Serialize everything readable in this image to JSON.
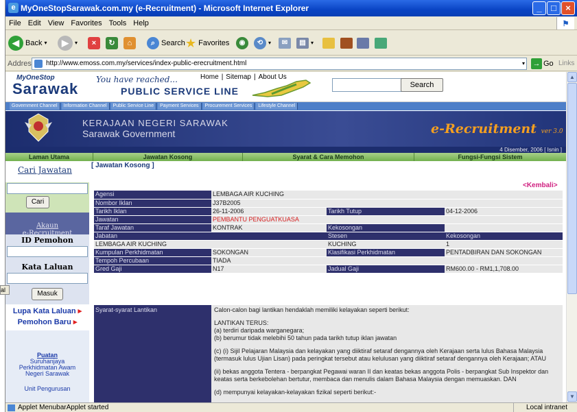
{
  "window": {
    "title": "MyOneStopSarawak.com.my (e-Recruitment) - Microsoft Internet Explorer",
    "left_label": "al"
  },
  "menu": [
    "File",
    "Edit",
    "View",
    "Favorites",
    "Tools",
    "Help"
  ],
  "toolbar": {
    "back": "Back",
    "search": "Search",
    "favorites": "Favorites"
  },
  "address": {
    "label": "Address",
    "url": "http://www.emoss.com.my/services/index-public-erecruitment.html",
    "go": "Go",
    "links": "Links"
  },
  "site": {
    "logo_top": "MyOneStop",
    "logo_main": "Sarawak",
    "tagline1": "You have reached...",
    "tagline2": "PUBLIC SERVICE LINE",
    "links": [
      "Home",
      "|",
      "Sitemap",
      "|",
      "About Us"
    ],
    "search_btn": "Search",
    "channels": [
      "Government Channel",
      "Information Channel",
      "Public Service Line",
      "Payment Services",
      "Procurement Services",
      "Lifestyle Channel"
    ]
  },
  "gov": {
    "name1": "KERAJAAN NEGERI SARAWAK",
    "name2": "Sarawak Government",
    "brand": "e-Recruitment",
    "version": "ver 3.0",
    "date": "4 Disember, 2006 [ Isnin ]"
  },
  "nav": [
    "Laman Utama",
    "Jawatan Kosong",
    "Syarat & Cara Memohon",
    "Fungsi-Fungsi Sistem"
  ],
  "sidebar": {
    "cari": "Cari Jawatan",
    "cari_btn": "Cari",
    "akaun1": "Akaun",
    "akaun2": "e-Recruitment",
    "id_label": "ID Pemohon",
    "kata_label": "Kata Laluan",
    "masuk": "Masuk",
    "lupa": "Lupa Kata Laluan",
    "baru": "Pemohon Baru",
    "puatan_title": "Puatan",
    "puatan_lines": [
      "Suruhanjaya",
      "Perkhidmatan Awam",
      "Negeri Sarawak"
    ],
    "unit": "Unit Pengurusan"
  },
  "content": {
    "header": "[ Jawatan Kosong ]",
    "kembali": "<Kembali>",
    "rows": {
      "agensi": {
        "l": "Agensi",
        "v": "LEMBAGA AIR KUCHING"
      },
      "nombor": {
        "l": "Nombor Iklan",
        "v": "J37B2005"
      },
      "tarikh": {
        "l": "Tarikh Iklan",
        "v": "26-11-2006",
        "l2": "Tarikh Tutup",
        "v2": "04-12-2006"
      },
      "jawatan": {
        "l": "Jawatan",
        "v": "PEMBANTU PENGUATKUASA"
      },
      "taraf": {
        "l": "Taraf Jawatan",
        "v": "KONTRAK",
        "l2": "Kekosongan",
        "v2": ""
      },
      "jabatan_hdr": {
        "l": "Jabatan",
        "l2": "Stesen",
        "l3": "Kekosongan"
      },
      "jabatan": {
        "v": "LEMBAGA AIR KUCHING",
        "v2": "KUCHING",
        "v3": "1"
      },
      "kumpulan": {
        "l": "Kumpulan Perkhidmatan",
        "v": "SOKONGAN",
        "l2": "Klasifikasi Perkhidmatan",
        "v2": "PENTADBIRAN DAN SOKONGAN"
      },
      "tempoh": {
        "l": "Tempoh Percubaan",
        "v": "TIADA"
      },
      "gred": {
        "l": "Gred Gaji",
        "v": "N17",
        "l2": "Jadual Gaji",
        "v2": "RM600.00 - RM1,1,708.00"
      }
    },
    "syarat_label": "Syarat-syarat Lantikan",
    "syarat_paras": [
      "Calon-calon bagi lantikan hendaklah memiliki kelayakan seperti berikut:",
      "LANTIKAN TERUS:",
      "(a) terdiri daripada warganegara;",
      "(b) berumur tidak melebihi 50 tahun pada tarikh tutup iklan jawatan",
      "(c) (i) Sijil Pelajaran Malaysia dan kelayakan yang diiktiraf setaraf dengannya oleh Kerajaan serta lulus Bahasa Malaysia (termasuk lulus Ujian Lisan) pada peringkat tersebut atau kelulusan yang diiktiraf setaraf dengannya oleh Kerajaan; ATAU",
      "(ii) bekas anggota Tentera - berpangkat Pegawai waran II dan keatas bekas anggota Polis - berpangkat Sub Inspektor dan keatas serta berkebolehan bertutur, membaca dan menulis dalam Bahasa Malaysia dengan memuaskan. DAN",
      "(d) mempunyai kelayakan-kelayakan fizikal seperti berikut:-"
    ]
  },
  "status": {
    "text": "Applet MenubarApplet started",
    "zone": "Local intranet"
  }
}
